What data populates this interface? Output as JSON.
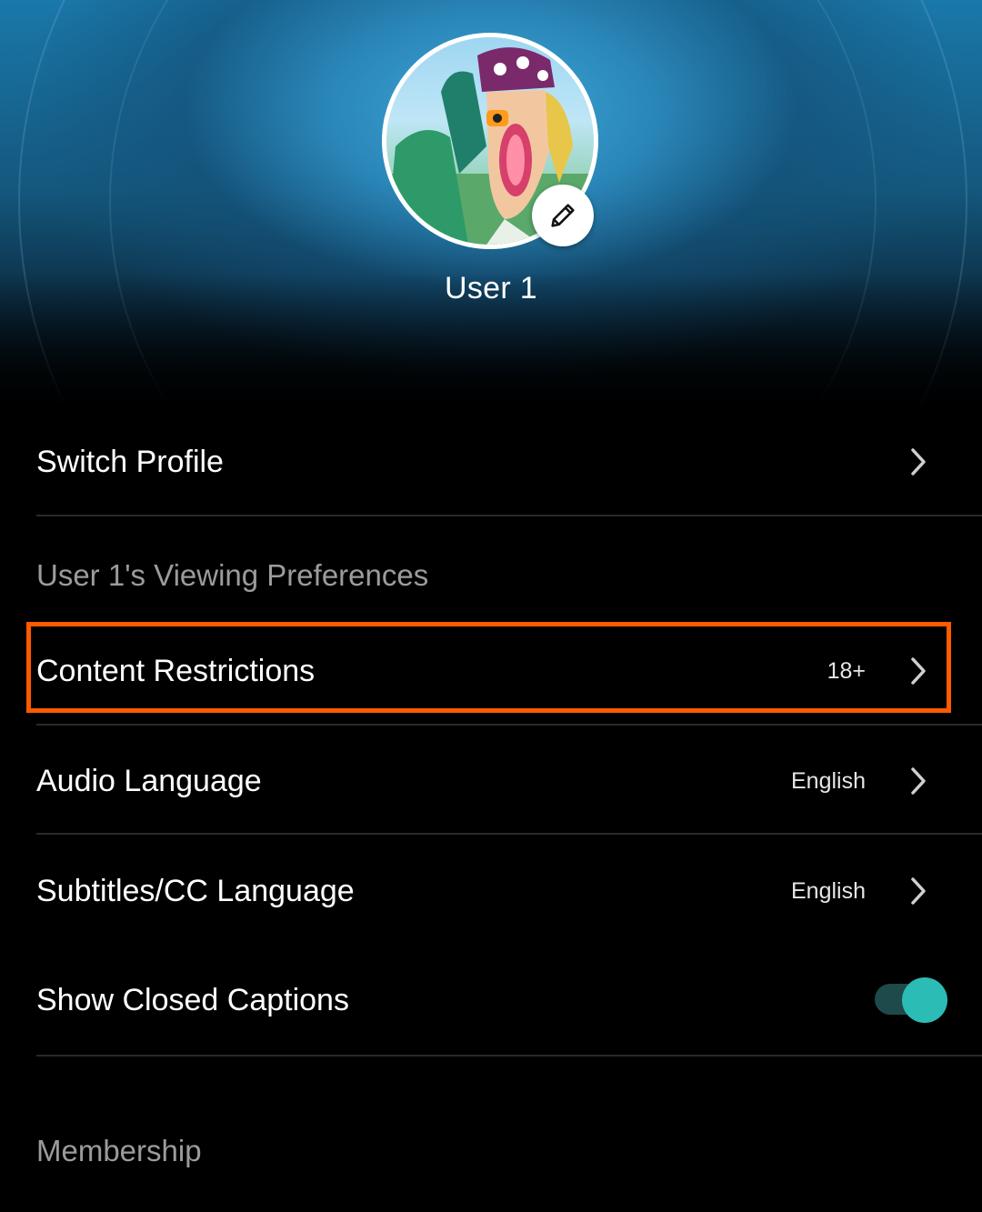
{
  "profile": {
    "name": "User 1"
  },
  "menu": {
    "switch_profile": "Switch Profile"
  },
  "preferences": {
    "section_title": "User 1's Viewing Preferences",
    "content_restrictions": {
      "label": "Content Restrictions",
      "value": "18+"
    },
    "audio_language": {
      "label": "Audio Language",
      "value": "English"
    },
    "subtitles_language": {
      "label": "Subtitles/CC Language",
      "value": "English"
    },
    "closed_captions": {
      "label": "Show Closed Captions",
      "enabled": true
    }
  },
  "membership": {
    "section_title": "Membership"
  },
  "colors": {
    "highlight": "#ff5a00",
    "toggle_on": "#2bbcb6",
    "section_text": "#9b9b9b",
    "background": "#000000"
  },
  "icons": {
    "edit": "pencil-icon",
    "chevron": "chevron-right-icon"
  }
}
